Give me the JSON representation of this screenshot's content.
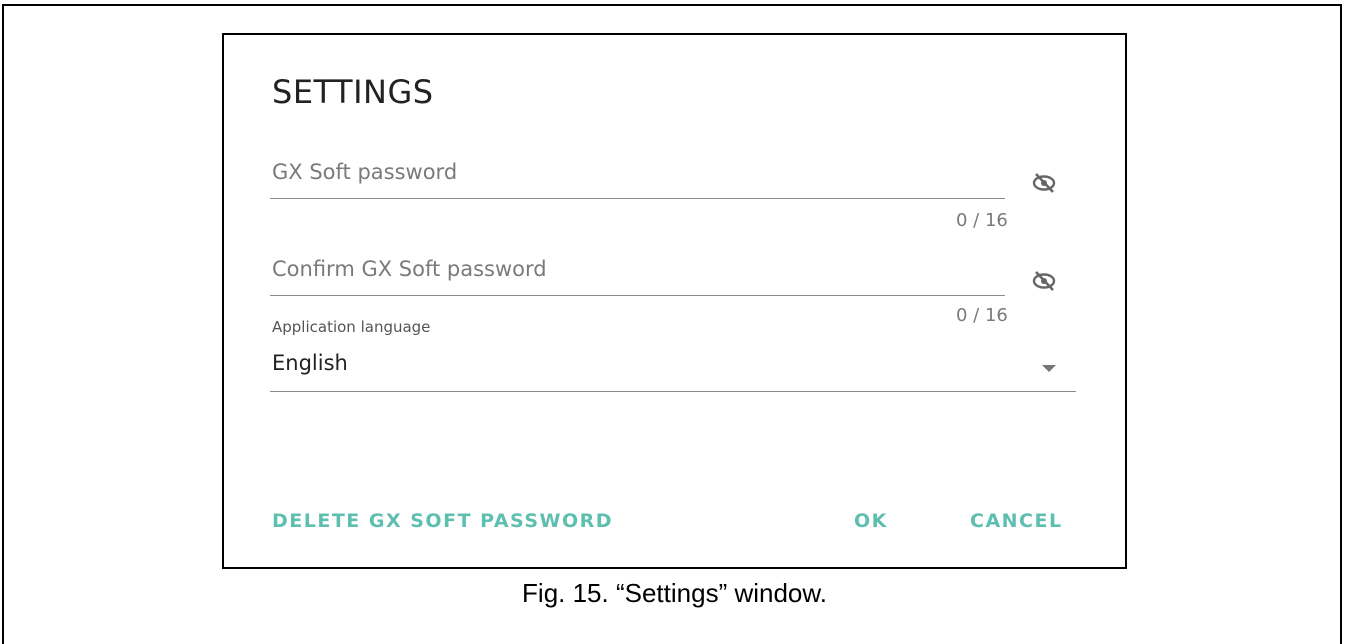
{
  "dialog": {
    "title": "SETTINGS",
    "password_field": {
      "placeholder": "GX Soft password",
      "counter": "0 / 16",
      "visibility_icon": "eye-off-icon"
    },
    "confirm_field": {
      "placeholder": "Confirm GX Soft password",
      "counter": "0 / 16",
      "visibility_icon": "eye-off-icon"
    },
    "language": {
      "label": "Application language",
      "value": "English",
      "dropdown_icon": "caret-down-icon"
    },
    "buttons": {
      "delete": "DELETE GX SOFT PASSWORD",
      "ok": "OK",
      "cancel": "CANCEL"
    }
  },
  "caption": "Fig. 15. “Settings” window.",
  "colors": {
    "accent": "#5ebfb0",
    "placeholder": "#7a7a7a",
    "underline": "#8a8a8a"
  }
}
